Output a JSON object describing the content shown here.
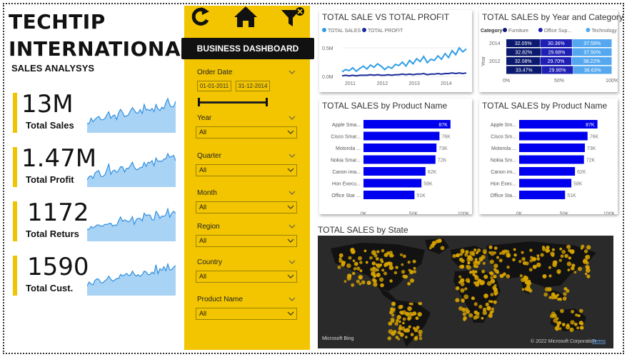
{
  "brand": {
    "line1": "TECHTIP",
    "line2": "INTERNATIONAL",
    "subtitle": "SALES ANALYSYS"
  },
  "kpis": [
    {
      "value": "13M",
      "label": "Total Sales"
    },
    {
      "value": "1.47M",
      "label": "Total Profit"
    },
    {
      "value": "1172",
      "label": "Total Returs"
    },
    {
      "value": "1590",
      "label": "Total Cust."
    }
  ],
  "toolbar": {
    "icons": [
      "refresh-icon",
      "home-icon",
      "clear-filter-icon"
    ],
    "banner": "BUSINESS DASHBOARD"
  },
  "slicers": {
    "order_date": {
      "label": "Order Date",
      "start": "01-01-2011",
      "end": "31-12-2014"
    },
    "year": {
      "label": "Year",
      "value": "All"
    },
    "quarter": {
      "label": "Quarter",
      "value": "All"
    },
    "month": {
      "label": "Month",
      "value": "All"
    },
    "region": {
      "label": "Region",
      "value": "All"
    },
    "country": {
      "label": "Country",
      "value": "All"
    },
    "product": {
      "label": "Product Name",
      "value": "All"
    }
  },
  "colors": {
    "accent_yellow": "#f2c500",
    "bar_blue": "#0000ee",
    "line_light": "#2f9de6",
    "line_dark": "#1a2a9c",
    "tech_blue": "#55a8f0"
  },
  "chart_data": [
    {
      "type": "line",
      "title": "TOTAL SALE VS TOTAL PROFIT",
      "x_ticks": [
        "2011",
        "2012",
        "2013",
        "2014"
      ],
      "y_ticks": [
        "0.0M",
        "0.5M"
      ],
      "ylim": [
        0,
        0.6
      ],
      "legend_position": "top-left",
      "series": [
        {
          "name": "TOTAL SALES",
          "values": [
            0.08,
            0.12,
            0.1,
            0.15,
            0.09,
            0.14,
            0.18,
            0.13,
            0.2,
            0.16,
            0.22,
            0.18,
            0.12,
            0.17,
            0.14,
            0.21,
            0.19,
            0.25,
            0.18,
            0.28,
            0.22,
            0.31,
            0.26,
            0.35,
            0.24,
            0.3,
            0.28,
            0.36,
            0.3,
            0.4,
            0.33,
            0.45,
            0.38,
            0.5,
            0.43,
            0.48
          ]
        },
        {
          "name": "TOTAL PROFIT",
          "values": [
            0.01,
            0.02,
            0.01,
            0.02,
            0.01,
            0.02,
            0.02,
            0.02,
            0.03,
            0.02,
            0.03,
            0.02,
            0.02,
            0.03,
            0.02,
            0.03,
            0.03,
            0.04,
            0.03,
            0.04,
            0.03,
            0.04,
            0.04,
            0.05,
            0.03,
            0.04,
            0.04,
            0.05,
            0.04,
            0.05,
            0.05,
            0.06,
            0.05,
            0.06,
            0.05,
            0.06
          ]
        }
      ]
    },
    {
      "type": "bar",
      "subtype": "100%-stacked-horizontal",
      "title": "TOTAL SALES by Year and Category",
      "legend_title": "Category",
      "legend_position": "top",
      "y_axis_label": "Year",
      "x_ticks": [
        "0%",
        "50%",
        "100%"
      ],
      "categories": [
        "2014",
        "2013",
        "2012",
        "2011"
      ],
      "series": [
        {
          "name": "Furniture",
          "color": "#0b1a6e",
          "values": [
            32.05,
            32.82,
            32.08,
            33.47
          ]
        },
        {
          "name": "Office Sup...",
          "color": "#1f1fb5",
          "values": [
            30.36,
            29.68,
            29.7,
            29.9
          ]
        },
        {
          "name": "Technology",
          "color": "#55a8f0",
          "values": [
            37.59,
            37.5,
            38.22,
            36.63
          ]
        }
      ],
      "value_labels": [
        [
          "32.05%",
          "30.36%",
          "37.59%"
        ],
        [
          "32.82%",
          "29.68%",
          "37.50%"
        ],
        [
          "32.08%",
          "29.70%",
          "38.22%"
        ],
        [
          "33.47%",
          "29.90%",
          "36.63%"
        ]
      ]
    },
    {
      "type": "bar",
      "title": "TOTAL SALES by Product Name",
      "categories": [
        "Apple Sma...",
        "Cisco Smar...",
        "Motorola ...",
        "Nokia Smar...",
        "Canon ima...",
        "Hon Execu...",
        "Office Star ..."
      ],
      "values": [
        87,
        76,
        73,
        72,
        62,
        58,
        51
      ],
      "value_labels": [
        "87K",
        "76K",
        "73K",
        "72K",
        "62K",
        "58K",
        "51K"
      ],
      "x_ticks": [
        "0K",
        "50K",
        "100K"
      ],
      "xlim": [
        0,
        100
      ]
    },
    {
      "type": "bar",
      "title": "TOTAL SALES by Product Name",
      "categories": [
        "Apple Sm...",
        "Cisco Sm...",
        "Motorola ...",
        "Nokia Sm...",
        "Canon im...",
        "Hon Exec...",
        "Office Sta..."
      ],
      "values": [
        87,
        76,
        73,
        72,
        62,
        58,
        51
      ],
      "value_labels": [
        "87K",
        "76K",
        "73K",
        "72K",
        "62K",
        "58K",
        "51K"
      ],
      "x_ticks": [
        "0K",
        "50K",
        "100K"
      ],
      "xlim": [
        0,
        100
      ]
    }
  ],
  "map": {
    "title": "TOTAL SALES by State",
    "logo": "Microsoft Bing",
    "copyright": "© 2022 Microsoft Corporation",
    "terms": "Terms"
  }
}
